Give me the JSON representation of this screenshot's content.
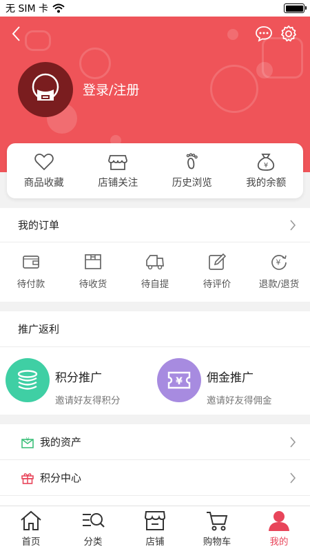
{
  "status_bar": {
    "carrier": "无 SIM 卡"
  },
  "header": {
    "login_label": "登录/注册"
  },
  "quick_links": [
    {
      "label": "商品收藏",
      "icon": "heart-icon"
    },
    {
      "label": "店铺关注",
      "icon": "store-icon"
    },
    {
      "label": "历史浏览",
      "icon": "footprint-icon"
    },
    {
      "label": "我的余额",
      "icon": "money-bag-icon"
    }
  ],
  "orders": {
    "title": "我的订单",
    "items": [
      {
        "label": "待付款",
        "icon": "wallet-icon"
      },
      {
        "label": "待收货",
        "icon": "box-icon"
      },
      {
        "label": "待自提",
        "icon": "truck-icon"
      },
      {
        "label": "待评价",
        "icon": "edit-icon"
      },
      {
        "label": "退款/退货",
        "icon": "refund-icon"
      }
    ]
  },
  "promotion": {
    "title": "推广返利",
    "items": [
      {
        "title": "积分推广",
        "subtitle": "邀请好友得积分",
        "color": "#3fcfa4",
        "icon": "coins-icon"
      },
      {
        "title": "佣金推广",
        "subtitle": "邀请好友得佣金",
        "color": "#a78be0",
        "icon": "yuan-ticket-icon"
      }
    ]
  },
  "menu": [
    {
      "label": "我的资产",
      "icon": "assets-icon",
      "color": "#3cc07a"
    },
    {
      "label": "积分中心",
      "icon": "gift-icon",
      "color": "#e8455a"
    }
  ],
  "tabs": [
    {
      "label": "首页",
      "icon": "home-icon"
    },
    {
      "label": "分类",
      "icon": "category-icon"
    },
    {
      "label": "店铺",
      "icon": "shop-icon"
    },
    {
      "label": "购物车",
      "icon": "cart-icon"
    },
    {
      "label": "我的",
      "icon": "user-icon",
      "active": true
    }
  ],
  "colors": {
    "brand_red": "#ef5459",
    "active_tab": "#e8455a"
  }
}
